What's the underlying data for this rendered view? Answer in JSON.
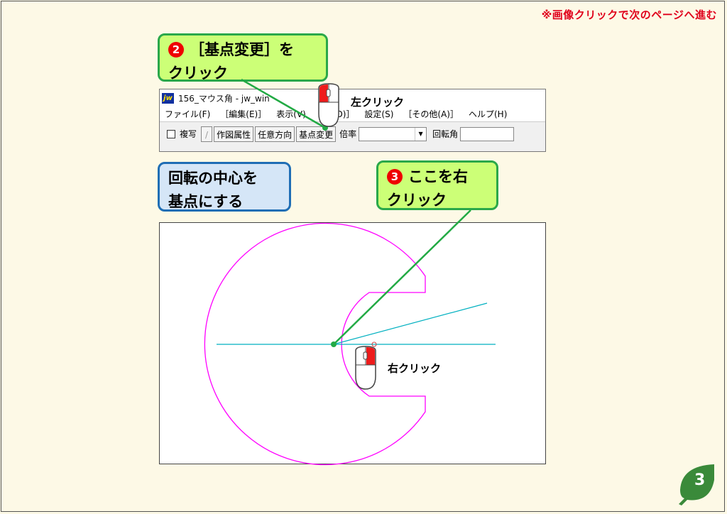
{
  "nav_hint": "※画像クリックで次のページへ進む",
  "step2": {
    "num": "2",
    "line1": "［基点変更］を",
    "line2": "クリック"
  },
  "step3": {
    "num": "3",
    "line1": "ここを右",
    "line2": "クリック"
  },
  "info": {
    "line1": "回転の中心を",
    "line2": "基点にする"
  },
  "app": {
    "logo": "jw",
    "title": "156_マウス角 - jw_win",
    "menus": [
      "ファイル(F)",
      "［編集(E)］",
      "表示(V)",
      "［作(D)］",
      "設定(S)",
      "［その他(A)］",
      "ヘルプ(H)"
    ],
    "toolbar": {
      "copy_label": "複写",
      "slash": "/",
      "draw_attr": "作図属性",
      "any_dir": "任意方向",
      "base_change": "基点変更",
      "scale_label": "倍率",
      "rotation_label": "回転角"
    }
  },
  "mouse_left_label": "左クリック",
  "mouse_right_label": "右クリック",
  "page_number": "3",
  "colors": {
    "callout_green": "#ccff77",
    "callout_border": "#2aa84a",
    "info_blue": "#d5e6f7",
    "shape": "#ff00ff",
    "guide": "#00b0c0",
    "leader": "#22aa44"
  }
}
